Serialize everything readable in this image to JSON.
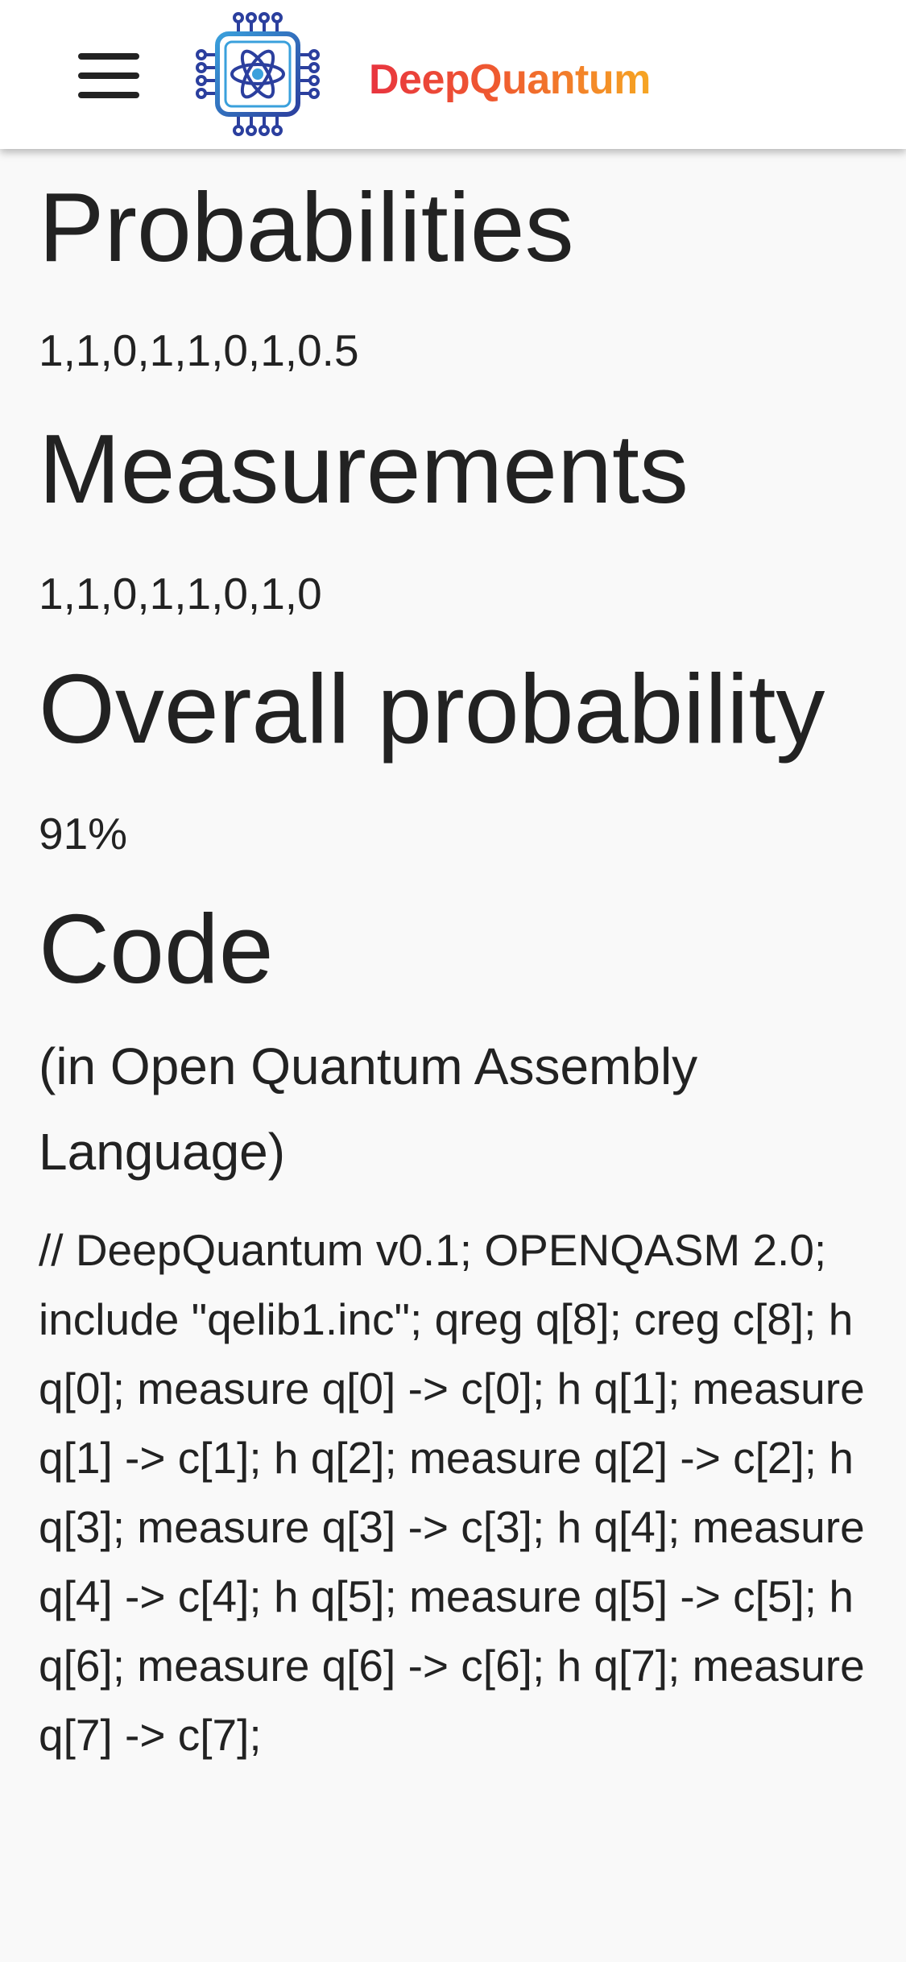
{
  "header": {
    "brand": "DeepQuantum",
    "menu_icon": "hamburger-menu-icon",
    "logo_icon": "quantum-chip-atom-icon",
    "colors": {
      "brand_start": "#e8343f",
      "brand_end": "#f6a623",
      "logo_blue_dark": "#2b3f9e",
      "logo_blue_light": "#3aa0dc"
    }
  },
  "sections": {
    "probabilities": {
      "title": "Probabilities",
      "value": "1,1,0,1,1,0,1,0.5"
    },
    "measurements": {
      "title": "Measurements",
      "value": "1,1,0,1,1,0,1,0"
    },
    "overall": {
      "title": "Overall probability",
      "value": "91%"
    },
    "code": {
      "title": "Code",
      "subtitle": "(in Open Quantum Assembly Language)",
      "body": "// DeepQuantum v0.1; OPENQASM 2.0; include \"qelib1.inc\"; qreg q[8]; creg c[8]; h q[0]; measure q[0] -> c[0]; h q[1]; measure q[1] -> c[1]; h q[2]; measure q[2] -> c[2]; h q[3]; measure q[3] -> c[3]; h q[4]; measure q[4] -> c[4]; h q[5]; measure q[5] -> c[5]; h q[6]; measure q[6] -> c[6]; h q[7]; measure q[7] -> c[7];"
    }
  }
}
